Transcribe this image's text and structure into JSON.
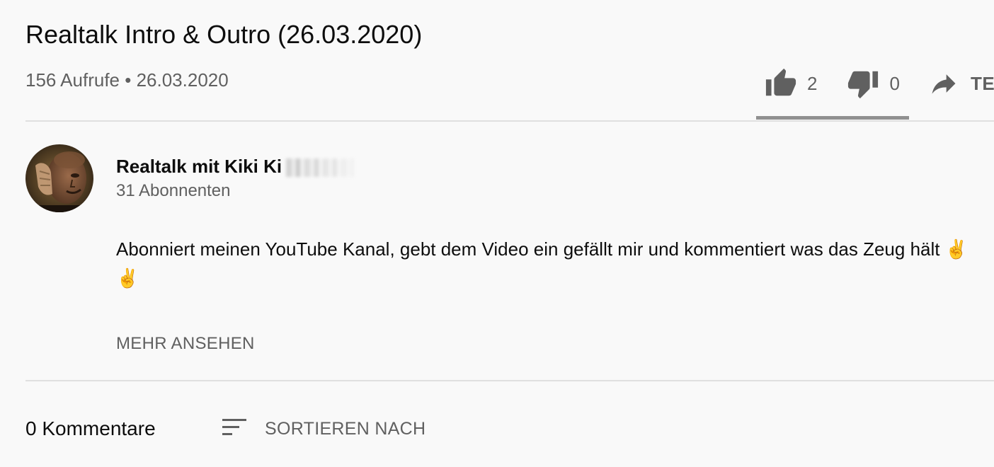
{
  "video": {
    "title": "Realtalk Intro & Outro (26.03.2020)",
    "views": "156 Aufrufe",
    "separator": "•",
    "date": "26.03.2020"
  },
  "actions": {
    "like_count": "2",
    "dislike_count": "0",
    "share_label": "TEILEN"
  },
  "channel": {
    "name": "Realtalk mit Kiki Ki",
    "subscribers": "31 Abonnenten",
    "avatar_icon": "channel-avatar"
  },
  "description": {
    "text": "Abonniert meinen YouTube Kanal, gebt dem Video ein gefällt mir und kommentiert was das Zeug hält ✌️ ✌️",
    "more_label": "MEHR ANSEHEN"
  },
  "comments": {
    "count_label": "0 Kommentare",
    "sort_label": "SORTIEREN NACH",
    "sort_icon": "sort-icon"
  },
  "colors": {
    "background": "#f9f9f9",
    "text_primary": "#0d0d0d",
    "text_secondary": "#606060",
    "divider": "#e0e0e0",
    "sentiment_bar": "#909090"
  }
}
